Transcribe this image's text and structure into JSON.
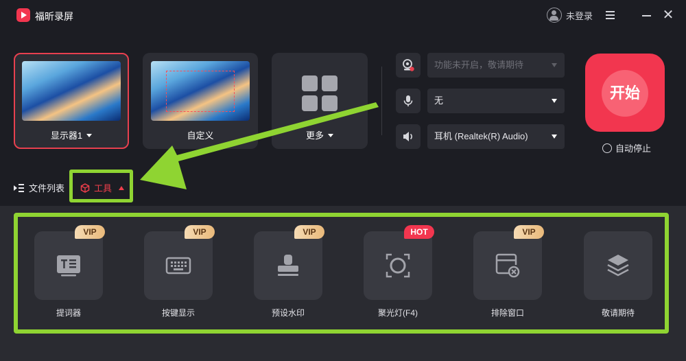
{
  "app": {
    "title": "福昕录屏",
    "login_label": "未登录"
  },
  "sources": [
    {
      "label": "显示器1"
    },
    {
      "label": "自定义"
    },
    {
      "label": "更多"
    }
  ],
  "devices": {
    "camera": "功能未开启，敬请期待",
    "microphone": "无",
    "speaker": "耳机 (Realtek(R) Audio)"
  },
  "start": {
    "label": "开始",
    "auto_stop_label": "自动停止"
  },
  "tabs": {
    "files": "文件列表",
    "tools": "工具"
  },
  "tools": [
    {
      "label": "提词器",
      "badge": "VIP"
    },
    {
      "label": "按键显示",
      "badge": "VIP"
    },
    {
      "label": "预设水印",
      "badge": "VIP"
    },
    {
      "label": "聚光灯(F4)",
      "badge": "HOT"
    },
    {
      "label": "排除窗口",
      "badge": "VIP"
    },
    {
      "label": "敬请期待",
      "badge": ""
    }
  ],
  "colors": {
    "accent": "#f2364f",
    "highlight": "#8fd432",
    "card": "#2c2d34",
    "panel": "#2a2b31"
  }
}
